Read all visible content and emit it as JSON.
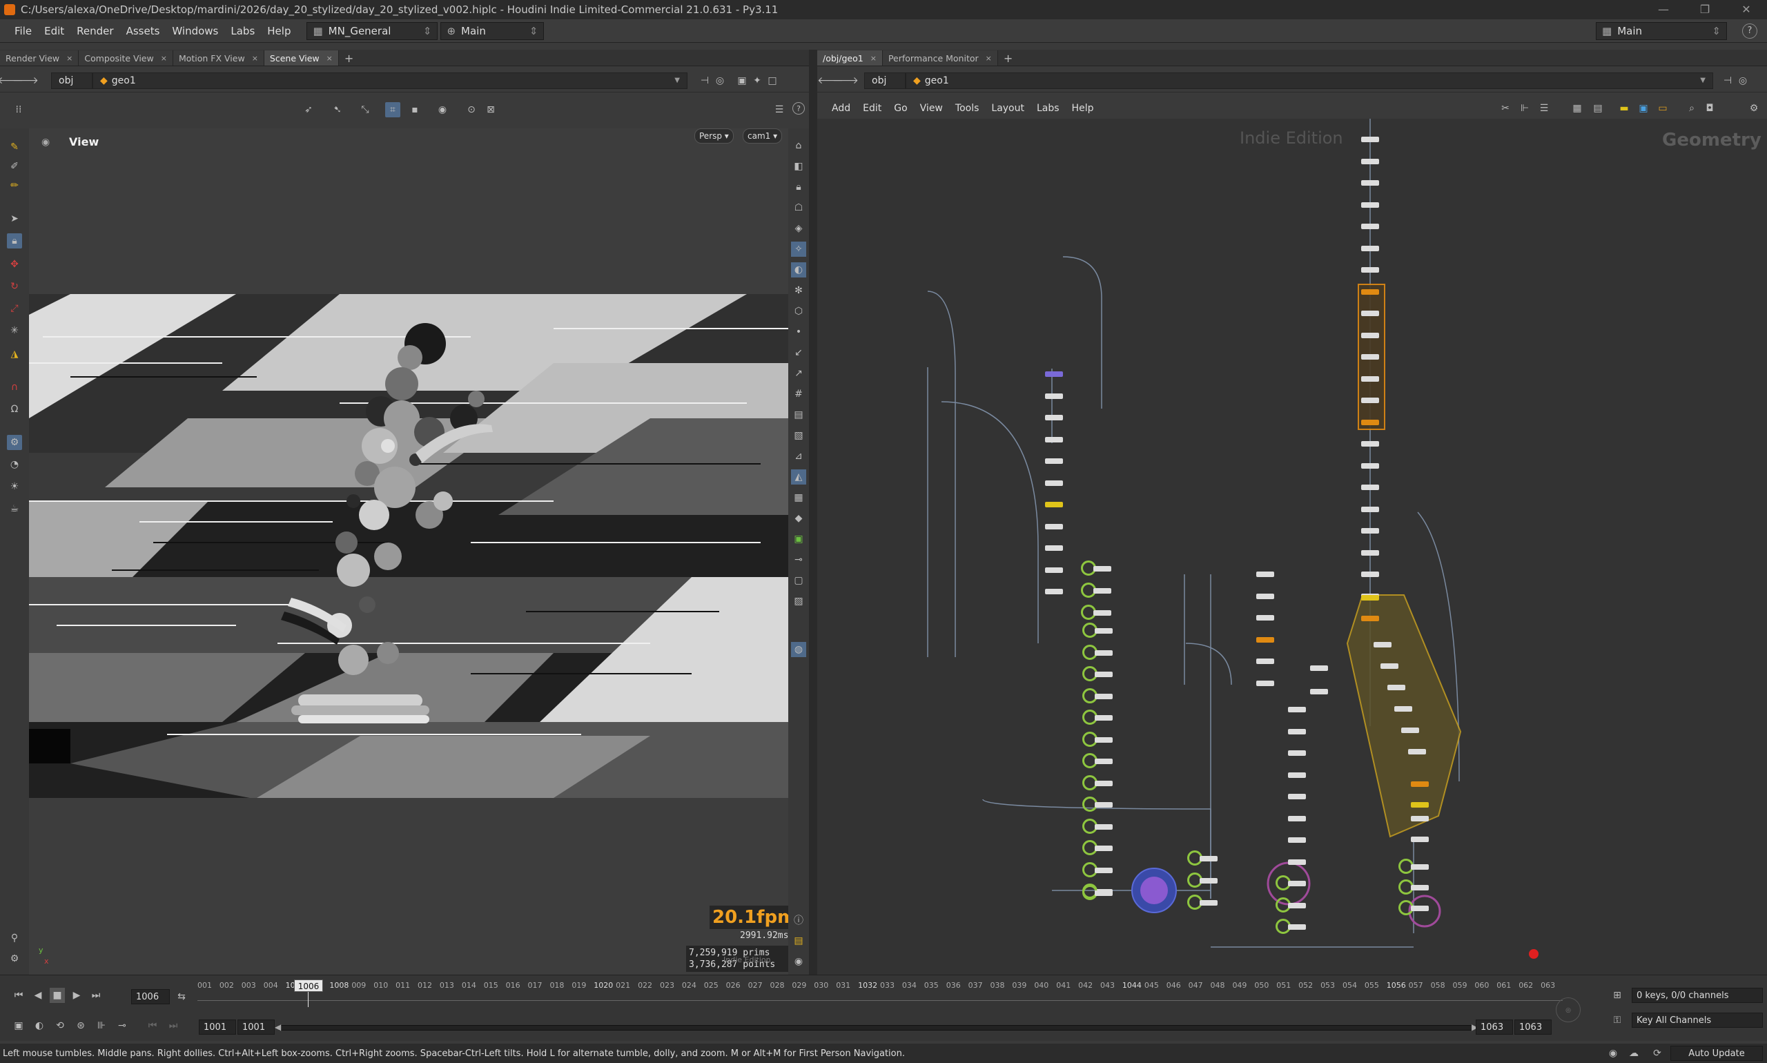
{
  "window": {
    "title": "C:/Users/alexa/OneDrive/Desktop/mardini/2026/day_20_stylized/day_20_stylized_v002.hiplc - Houdini Indie Limited-Commercial 21.0.631 - Py3.11",
    "controls": [
      "—",
      "❐",
      "✕"
    ]
  },
  "menubar": {
    "items": [
      "File",
      "Edit",
      "Render",
      "Assets",
      "Windows",
      "Labs",
      "Help"
    ],
    "desktop": "MN_General",
    "context": "Main",
    "right_desktop": "Main"
  },
  "left_pane": {
    "tabs": [
      "Render View",
      "Composite View",
      "Motion FX View",
      "Scene View"
    ],
    "active_tab": "Scene View",
    "path_obj": "obj",
    "path_geo": "geo1",
    "viewport_label": "View",
    "persp_btn": "Persp ▾",
    "cam_btn": "cam1 ▾",
    "fps": "20.1fpm",
    "ms": "2991.92ms",
    "prims_label": "7,259,919  prims",
    "points_label": "3,736,287 points",
    "indie_watermark": "Indie Edition",
    "axis_y": "y",
    "axis_x": "x"
  },
  "right_pane": {
    "tabs": [
      "/obj/geo1",
      "Performance Monitor"
    ],
    "active_tab": "/obj/geo1",
    "path_obj": "obj",
    "path_geo": "geo1",
    "menu": [
      "Add",
      "Edit",
      "Go",
      "View",
      "Tools",
      "Layout",
      "Labs",
      "Help"
    ],
    "watermark_indie": "Indie Edition",
    "watermark_context": "Geometry"
  },
  "timeline": {
    "current_frame": "1006",
    "marker": "1006",
    "start": "1001",
    "start2": "1001",
    "end": "1063",
    "end2": "1063",
    "ticks": [
      "001",
      "002",
      "003",
      "004",
      "1006",
      "007",
      "1008",
      "009",
      "010",
      "011",
      "012",
      "013",
      "014",
      "015",
      "016",
      "017",
      "018",
      "019",
      "1020",
      "021",
      "022",
      "023",
      "024",
      "025",
      "026",
      "027",
      "028",
      "029",
      "030",
      "031",
      "1032",
      "033",
      "034",
      "035",
      "036",
      "037",
      "038",
      "039",
      "040",
      "041",
      "042",
      "043",
      "1044",
      "045",
      "046",
      "047",
      "048",
      "049",
      "050",
      "051",
      "052",
      "053",
      "054",
      "055",
      "1056",
      "057",
      "058",
      "059",
      "060",
      "061",
      "062",
      "063"
    ],
    "keys_channels": "0 keys, 0/0 channels",
    "key_all": "Key All Channels"
  },
  "status": {
    "hint": "Left mouse tumbles. Middle pans. Right dollies. Ctrl+Alt+Left box-zooms. Ctrl+Right zooms. Spacebar-Ctrl-Left tilts. Hold L for alternate tumble, dolly, and zoom. M or Alt+M for First Person Navigation.",
    "auto_update": "Auto Update"
  },
  "colors": {
    "accent_orange": "#f0a020",
    "node_green": "#8ec63f",
    "network_bg": "#333333"
  }
}
